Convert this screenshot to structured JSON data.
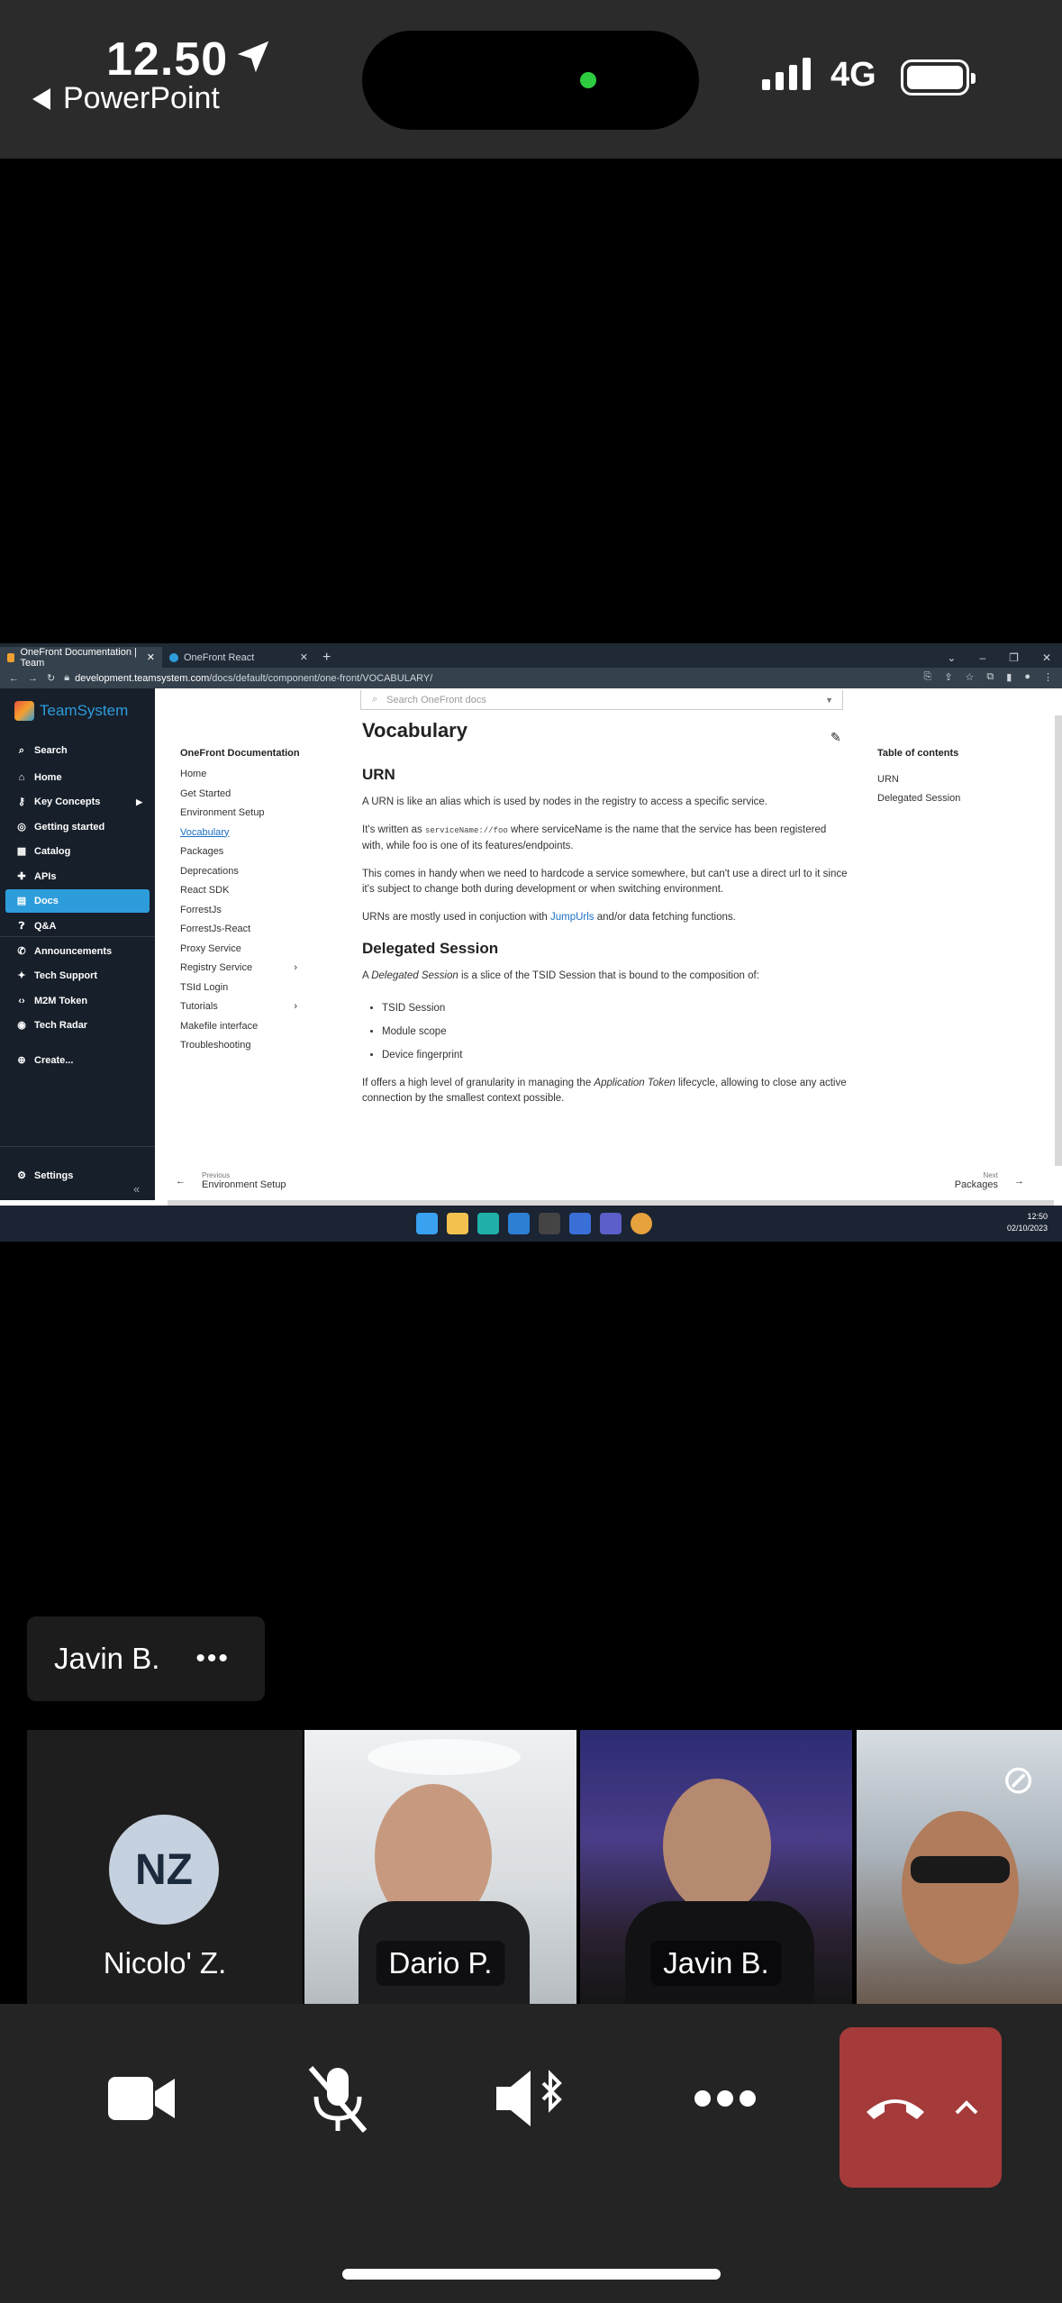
{
  "status_bar": {
    "time": "12.50",
    "back_app": "PowerPoint",
    "network": "4G"
  },
  "browser": {
    "tabs": [
      {
        "label": "OneFront Documentation | Team"
      },
      {
        "label": "OneFront React"
      }
    ],
    "url_domain": "development.teamsystem.com",
    "url_path": "/docs/default/component/one-front/VOCABULARY/"
  },
  "sidebar": {
    "brand": "TeamSystem",
    "items": [
      {
        "label": "Search",
        "icon": "search-icon"
      },
      {
        "label": "Home",
        "icon": "home-icon"
      },
      {
        "label": "Key Concepts",
        "icon": "key-icon"
      },
      {
        "label": "Getting started",
        "icon": "compass-icon"
      },
      {
        "label": "Catalog",
        "icon": "catalog-icon"
      },
      {
        "label": "APIs",
        "icon": "puzzle-icon"
      },
      {
        "label": "Docs",
        "icon": "docs-icon"
      },
      {
        "label": "Q&A",
        "icon": "qa-icon"
      },
      {
        "label": "Announcements",
        "icon": "megaphone-icon"
      },
      {
        "label": "Tech Support",
        "icon": "support-icon"
      },
      {
        "label": "M2M Token",
        "icon": "code-icon"
      },
      {
        "label": "Tech Radar",
        "icon": "radar-icon"
      },
      {
        "label": "Create...",
        "icon": "plus-circle-icon"
      },
      {
        "label": "Settings",
        "icon": "gear-icon"
      }
    ]
  },
  "docs": {
    "search_placeholder": "Search OneFront docs",
    "nav_title": "OneFront Documentation",
    "nav_items": [
      {
        "label": "Home"
      },
      {
        "label": "Get Started"
      },
      {
        "label": "Environment Setup"
      },
      {
        "label": "Vocabulary"
      },
      {
        "label": "Packages"
      },
      {
        "label": "Deprecations"
      },
      {
        "label": "React SDK"
      },
      {
        "label": "ForrestJs"
      },
      {
        "label": "ForrestJs-React"
      },
      {
        "label": "Proxy Service"
      },
      {
        "label": "Registry Service"
      },
      {
        "label": "TSId Login"
      },
      {
        "label": "Tutorials"
      },
      {
        "label": "Makefile interface"
      },
      {
        "label": "Troubleshooting"
      }
    ],
    "article": {
      "title": "Vocabulary",
      "h_urn": "URN",
      "p1": "A URN is like an alias which is used by nodes in the registry to access a specific service.",
      "p2_a": "It's written as ",
      "p2_code": "serviceName://foo",
      "p2_b": " where serviceName is the name that the service has been registered with, while foo is one of its features/endpoints.",
      "p3": "This comes in handy when we need to hardcode a service somewhere, but can't use a direct url to it since it's subject to change both during development or when switching environment.",
      "p4_a": "URNs are mostly used in conjuction with ",
      "p4_link": "JumpUrls",
      "p4_b": " and/or data fetching functions.",
      "h_delegated": "Delegated Session",
      "p5_a": "A ",
      "p5_em": "Delegated Session",
      "p5_b": " is a slice of the TSID Session that is bound to the composition of:",
      "bullets": [
        "TSID Session",
        "Module scope",
        "Device fingerprint"
      ],
      "p6_a": "If offers a high level of granularity in managing the ",
      "p6_em": "Application Token",
      "p6_b": " lifecycle, allowing to close any active connection by the smallest context possible."
    },
    "toc_title": "Table of contents",
    "toc_items": [
      "URN",
      "Delegated Session"
    ],
    "prev_small": "Previous",
    "prev_label": "Environment Setup",
    "next_small": "Next",
    "next_label": "Packages"
  },
  "taskbar": {
    "time": "12:50",
    "date": "02/10/2023"
  },
  "call": {
    "active_speaker": "Javin B.",
    "participants": [
      {
        "name": "Nicolo' Z.",
        "initials": "NZ"
      },
      {
        "name": "Dario P."
      },
      {
        "name": "Javin B."
      }
    ]
  }
}
